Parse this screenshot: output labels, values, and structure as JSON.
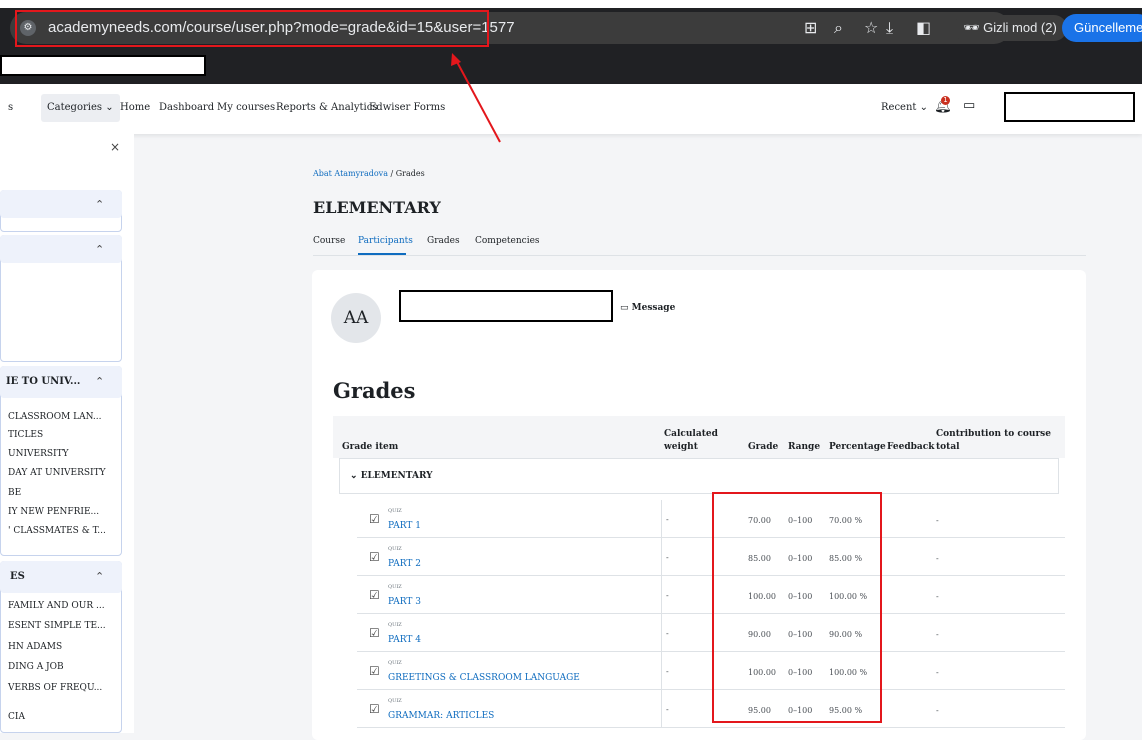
{
  "browser": {
    "url": "academyneeds.com/course/user.php?mode=grade&id=15&user=1577",
    "incognito_label": "Gizli mod (2)",
    "update_label": "Güncelleme",
    "icons": [
      "site-info-icon",
      "translate-icon",
      "zoom-icon",
      "bookmark-star-icon",
      "download-icon",
      "side-panel-icon",
      "incognito-icon"
    ]
  },
  "navbar": {
    "partial_left": "s",
    "categories": "Categories",
    "items": [
      "Home",
      "Dashboard",
      "My courses",
      "Reports & Analytics",
      "Edwiser Forms"
    ],
    "recent": "Recent",
    "notification_count": "1"
  },
  "sidebar": {
    "sections": [
      {
        "title": ""
      },
      {
        "title": ""
      },
      {
        "title": "IE TO UNIV...",
        "items": [
          "CLASSROOM LAN...",
          "TICLES",
          "UNIVERSITY",
          "DAY AT UNIVERSITY",
          "BE",
          "IY NEW PENFRIE...",
          "' CLASSMATES & T..."
        ]
      },
      {
        "title": "ES",
        "items": [
          "FAMILY AND OUR ...",
          "ESENT SIMPLE TE...",
          "HN ADAMS",
          "DING A JOB",
          "VERBS OF FREQU...",
          "CIA"
        ]
      }
    ]
  },
  "main": {
    "breadcrumb": {
      "user": "Abat Atamyradova",
      "sep": "/",
      "current": "Grades"
    },
    "course_title": "ELEMENTARY",
    "tabs": [
      "Course",
      "Participants",
      "Grades",
      "Competencies"
    ],
    "active_tab": "Participants",
    "avatar_initials": "AA",
    "message_label": "Message",
    "grades_heading": "Grades"
  },
  "table": {
    "headers": {
      "item": "Grade item",
      "weight_line1": "Calculated",
      "weight_line2": "weight",
      "grade": "Grade",
      "range": "Range",
      "percentage": "Percentage",
      "feedback": "Feedback",
      "contribution_line1": "Contribution to course",
      "contribution_line2": "total"
    },
    "category": "ELEMENTARY",
    "rows": [
      {
        "type": "QUIZ",
        "name": "PART 1",
        "weight": "-",
        "grade": "70.00",
        "range": "0–100",
        "percentage": "70.00 %",
        "contribution": "-"
      },
      {
        "type": "QUIZ",
        "name": "PART 2",
        "weight": "-",
        "grade": "85.00",
        "range": "0–100",
        "percentage": "85.00 %",
        "contribution": "-"
      },
      {
        "type": "QUIZ",
        "name": "PART 3",
        "weight": "-",
        "grade": "100.00",
        "range": "0–100",
        "percentage": "100.00 %",
        "contribution": "-"
      },
      {
        "type": "QUIZ",
        "name": "PART 4",
        "weight": "-",
        "grade": "90.00",
        "range": "0–100",
        "percentage": "90.00 %",
        "contribution": "-"
      },
      {
        "type": "QUIZ",
        "name": "GREETINGS & CLASSROOM LANGUAGE",
        "weight": "-",
        "grade": "100.00",
        "range": "0–100",
        "percentage": "100.00 %",
        "contribution": "-"
      },
      {
        "type": "QUIZ",
        "name": "GRAMMAR: ARTICLES",
        "weight": "-",
        "grade": "95.00",
        "range": "0–100",
        "percentage": "95.00 %",
        "contribution": "-"
      }
    ]
  },
  "annotation_color": "#e3171c"
}
